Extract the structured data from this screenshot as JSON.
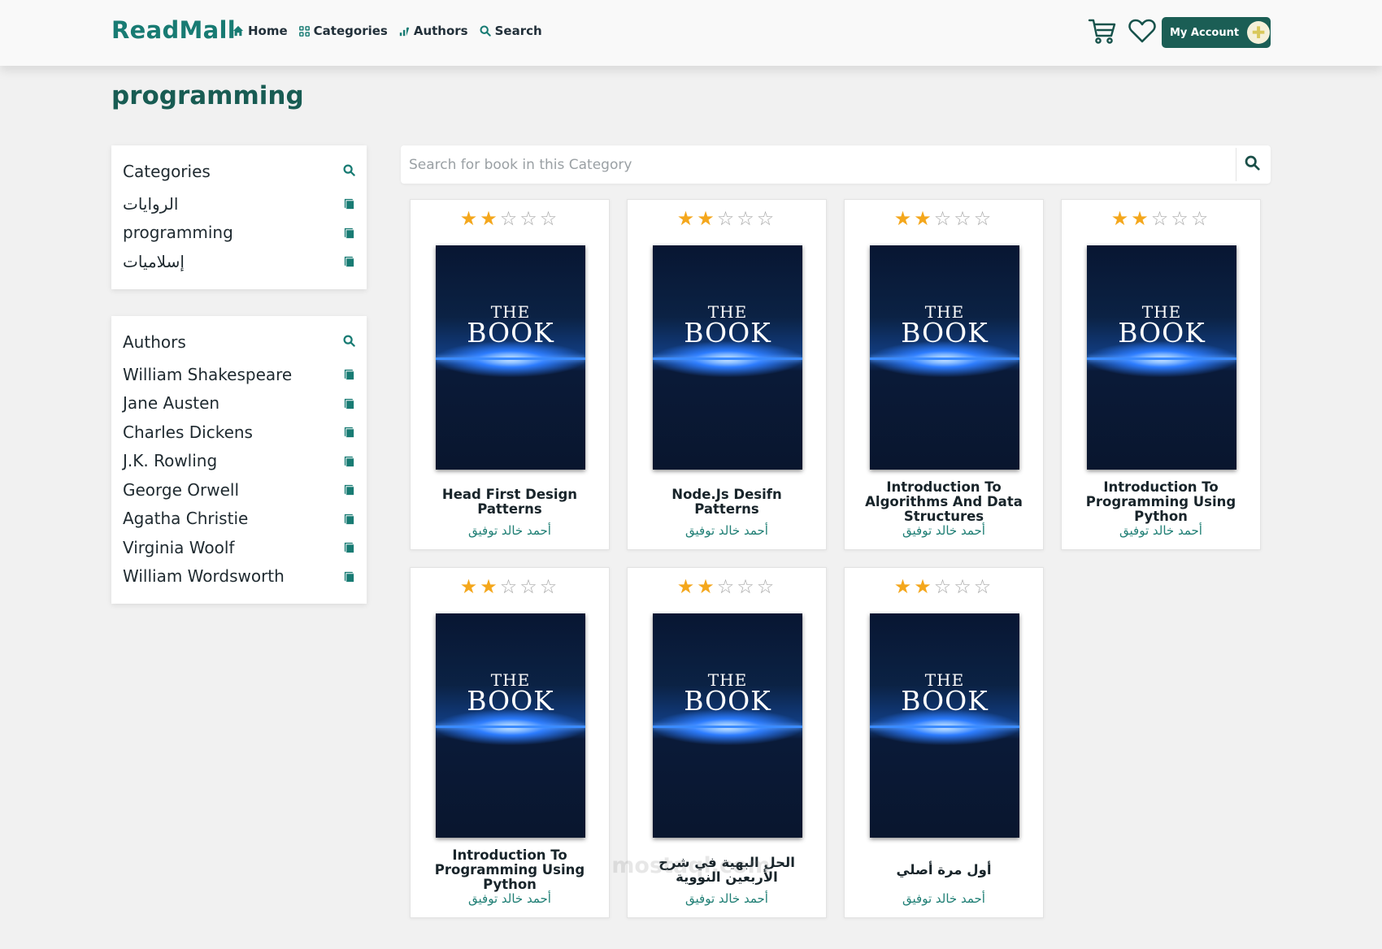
{
  "header": {
    "brand": "ReadMall",
    "nav": [
      {
        "label": "Home",
        "icon": "home-icon"
      },
      {
        "label": "Categories",
        "icon": "grid-icon"
      },
      {
        "label": "Authors",
        "icon": "feather-icon"
      },
      {
        "label": "Search",
        "icon": "search-icon"
      }
    ],
    "cart_icon": "cart-icon",
    "wishlist_icon": "heart-icon",
    "account_label": "My Account",
    "accent_color": "#187b73",
    "account_button_color": "#1b5e55"
  },
  "page": {
    "title": "programming"
  },
  "sidebar": {
    "categories": {
      "title": "Categories",
      "items": [
        "الروايات",
        "programming",
        "إسلاميات"
      ]
    },
    "authors": {
      "title": "Authors",
      "items": [
        "William Shakespeare",
        "Jane Austen",
        "Charles Dickens",
        "J.K. Rowling",
        "George Orwell",
        "Agatha Christie",
        "Virginia Woolf",
        "William Wordsworth"
      ]
    }
  },
  "search": {
    "placeholder": "Search for book in this Category",
    "value": ""
  },
  "books": [
    {
      "title": "Head First Design Patterns",
      "author": "أحمد خالد توفيق",
      "rating": 2,
      "max_rating": 5,
      "cover_the": "THE",
      "cover_book": "BOOK"
    },
    {
      "title": "Node.Js Desifn Patterns",
      "author": "أحمد خالد توفيق",
      "rating": 2,
      "max_rating": 5,
      "cover_the": "THE",
      "cover_book": "BOOK"
    },
    {
      "title": "Introduction To Algorithms And Data Structures",
      "author": "أحمد خالد توفيق",
      "rating": 2,
      "max_rating": 5,
      "cover_the": "THE",
      "cover_book": "BOOK"
    },
    {
      "title": "Introduction To Programming Using Python",
      "author": "أحمد خالد توفيق",
      "rating": 2,
      "max_rating": 5,
      "cover_the": "THE",
      "cover_book": "BOOK"
    },
    {
      "title": "Introduction To Programming Using Python",
      "author": "أحمد خالد توفيق",
      "rating": 2,
      "max_rating": 5,
      "cover_the": "THE",
      "cover_book": "BOOK"
    },
    {
      "title": "الحل البهية في شرح الأربعين النووية",
      "author": "أحمد خالد توفيق",
      "rating": 2,
      "max_rating": 5,
      "cover_the": "THE",
      "cover_book": "BOOK"
    },
    {
      "title": "أول مرة أصلي",
      "author": "أحمد خالد توفيق",
      "rating": 2,
      "max_rating": 5,
      "cover_the": "THE",
      "cover_book": "BOOK"
    }
  ],
  "watermark": "mostaql.com"
}
